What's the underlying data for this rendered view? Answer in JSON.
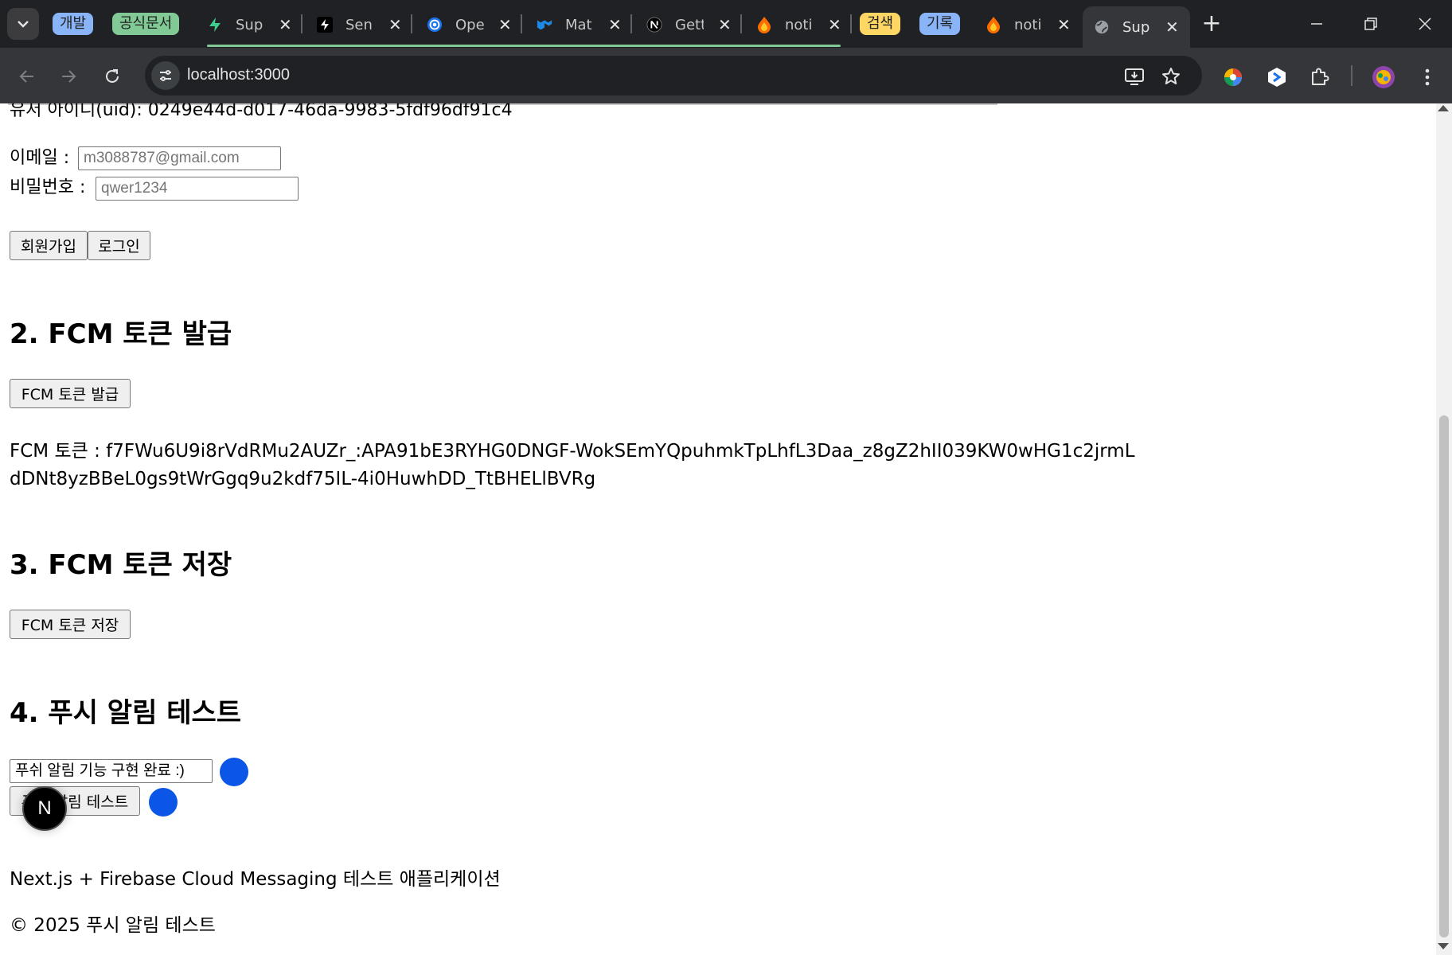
{
  "browser": {
    "tab_groups": [
      {
        "label": "개발",
        "color": "#8ab4f8"
      },
      {
        "label": "공식문서",
        "color": "#81c995"
      },
      {
        "label": "검색",
        "color": "#fdd663"
      },
      {
        "label": "기록",
        "color": "#8ab4f8"
      }
    ],
    "tabs": [
      {
        "title": "Sup",
        "icon": "supabase-icon"
      },
      {
        "title": "Sen",
        "icon": "bolt-icon"
      },
      {
        "title": "Ope",
        "icon": "openai-icon"
      },
      {
        "title": "Mat",
        "icon": "mui-icon"
      },
      {
        "title": "Gett",
        "icon": "nextjs-icon"
      },
      {
        "title": "noti",
        "icon": "firebase-icon"
      },
      {
        "title": "noti",
        "icon": "firebase-icon"
      },
      {
        "title": "Sup",
        "icon": "globe-icon"
      }
    ],
    "url": "localhost:3000"
  },
  "page": {
    "uid_text": "유저 아이디(uid): 0249e44d-d017-46da-9983-5fdf96df91c4",
    "email_label": "이메일 :",
    "email_placeholder": "m3088787@gmail.com",
    "password_label": "비밀번호 :",
    "password_placeholder": "qwer1234",
    "signup_button": "회원가입",
    "login_button": "로그인",
    "section2_title": "2. FCM 토큰 발급",
    "issue_token_button": "FCM 토큰 발급",
    "token_text": "FCM 토큰 : f7FWu6U9i8rVdRMu2AUZr_:APA91bE3RYHG0DNGF-WokSEmYQpuhmkTpLhfL3Daa_z8gZ2hII039KW0wHG1c2jrmLdDNt8yzBBeL0gs9tWrGgq9u2kdf75IL-4i0HuwhDD_TtBHELlBVRg",
    "section3_title": "3. FCM 토큰 저장",
    "save_token_button": "FCM 토큰 저장",
    "section4_title": "4. 푸시 알림 테스트",
    "push_message_value": "푸쉬 알림 기능 구현 완료 :)",
    "push_test_button": "푸시 알림 테스트",
    "footer_line1": "Next.js + Firebase Cloud Messaging 테스트 애플리케이션",
    "footer_line2": "© 2025 푸시 알림 테스트",
    "badge_letter": "N",
    "accent_color": "#0b56e6"
  }
}
